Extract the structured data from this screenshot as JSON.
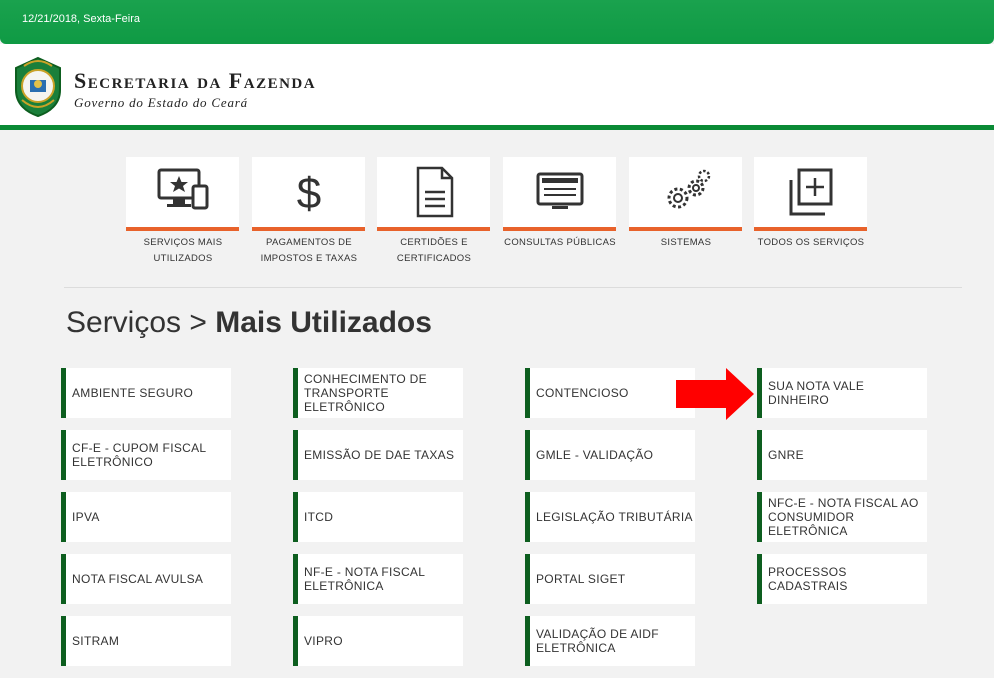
{
  "topbar": {
    "date": "12/21/2018, Sexta-Feira"
  },
  "header": {
    "title": "Secretaria da Fazenda",
    "subtitle": "Governo do Estado do Ceará",
    "crest_icon": "ceara-crest-icon",
    "border_color": "#0a8a35"
  },
  "categories": [
    {
      "label": "SERVIÇOS MAIS UTILIZADOS",
      "icon": "monitor-star-icon"
    },
    {
      "label": "PAGAMENTOS DE IMPOSTOS E TAXAS",
      "icon": "dollar-icon"
    },
    {
      "label": "CERTIDÕES E CERTIFICADOS",
      "icon": "document-icon"
    },
    {
      "label": "CONSULTAS PÚBLICAS",
      "icon": "screen-icon"
    },
    {
      "label": "SISTEMAS",
      "icon": "gears-icon"
    },
    {
      "label": "TODOS OS SERVIÇOS",
      "icon": "add-layers-icon"
    }
  ],
  "page_title": {
    "prefix": "Serviços > ",
    "bold": "Mais Utilizados"
  },
  "services": [
    [
      "AMBIENTE SEGURO",
      "CF-E - CUPOM FISCAL ELETRÔNICO",
      "IPVA",
      "NOTA FISCAL AVULSA",
      "SITRAM"
    ],
    [
      "CONHECIMENTO DE TRANSPORTE ELETRÔNICO",
      "EMISSÃO DE DAE TAXAS",
      "ITCD",
      "NF-E - NOTA FISCAL ELETRÔNICA",
      "VIPRO"
    ],
    [
      "CONTENCIOSO",
      "GMLE - VALIDAÇÃO",
      "LEGISLAÇÃO TRIBUTÁRIA",
      "PORTAL SIGET",
      "VALIDAÇÃO DE AIDF ELETRÔNICA"
    ],
    [
      "SUA NOTA VALE DINHEIRO",
      "GNRE",
      "NFC-E - NOTA FISCAL AO CONSUMIDOR ELETRÔNICA",
      "PROCESSOS CADASTRAIS"
    ]
  ],
  "colors": {
    "accent_orange": "#e8622b",
    "service_border": "#0d5e1f",
    "arrow": "#ff0000"
  }
}
